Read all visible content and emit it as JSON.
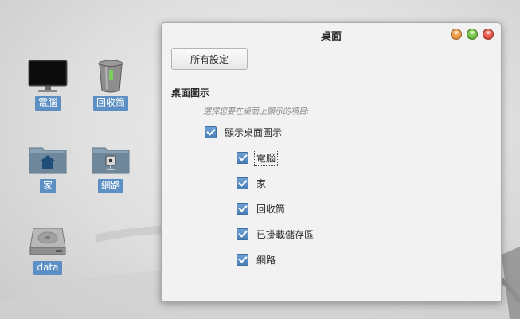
{
  "desktop": {
    "icons": [
      {
        "label": "電腦",
        "icon": "monitor-icon"
      },
      {
        "label": "回收筒",
        "icon": "trash-icon"
      },
      {
        "label": "家",
        "icon": "home-folder-icon"
      },
      {
        "label": "網路",
        "icon": "network-folder-icon"
      },
      {
        "label": "data",
        "icon": "hard-drive-icon"
      }
    ]
  },
  "window": {
    "title": "桌面",
    "buttons": {
      "minimize": "minimize-icon",
      "maximize": "maximize-icon",
      "close": "close-icon"
    },
    "toolbar": {
      "all_settings_label": "所有設定"
    },
    "section": {
      "title": "桌面圖示",
      "hint": "選擇您要在桌面上顯示的項目:",
      "master": {
        "label": "顯示桌面圖示",
        "checked": true
      },
      "items": [
        {
          "label": "電腦",
          "checked": true
        },
        {
          "label": "家",
          "checked": true
        },
        {
          "label": "回收筒",
          "checked": true
        },
        {
          "label": "已掛載儲存區",
          "checked": true
        },
        {
          "label": "網路",
          "checked": true
        }
      ]
    }
  },
  "colors": {
    "accent": "#5c8fc4",
    "checkbox": "#4a7fb7"
  }
}
